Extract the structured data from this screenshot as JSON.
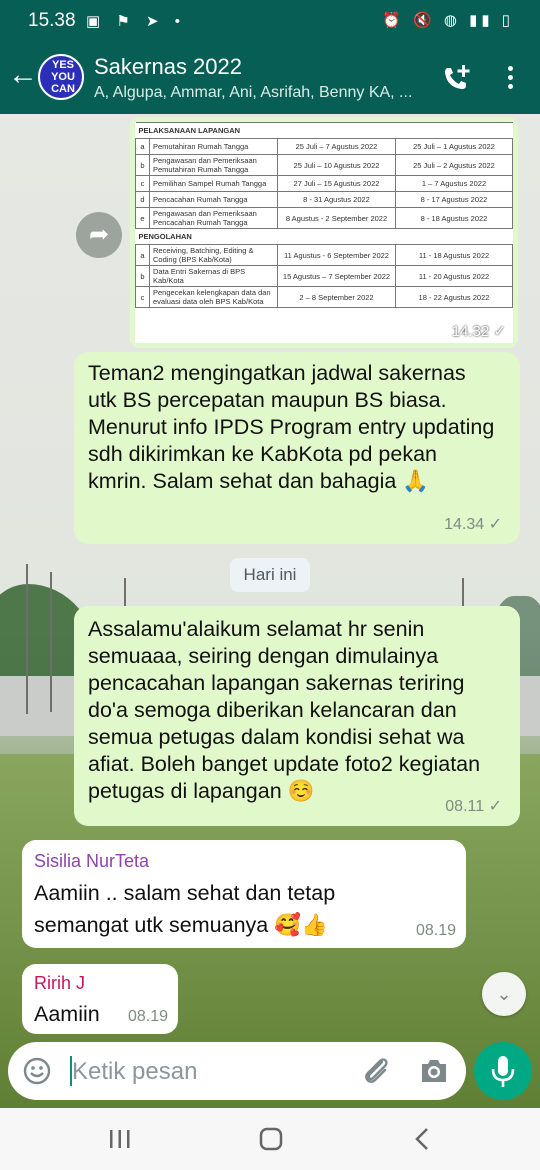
{
  "status_bar": {
    "time": "15.38"
  },
  "header": {
    "avatar_text": [
      "YES",
      "YOU",
      "CAN"
    ],
    "title": "Sakernas 2022",
    "members": "A, Algupa, Ammar, Ani, Asrifah, Benny KA, ..."
  },
  "image_message": {
    "time": "14.32",
    "sections": [
      {
        "title": "PELAKSANAAN LAPANGAN",
        "rows": [
          {
            "k": "a",
            "activity": "Pemutahiran Rumah Tangga",
            "bs_percepatan": "25 Juli – 7 Agustus 2022",
            "bs_biasa": "25 Juli – 1 Agustus 2022"
          },
          {
            "k": "b",
            "activity": "Pengawasan dan Pemeriksaan Pemutahiran Rumah Tangga",
            "bs_percepatan": "25 Juli – 10 Agustus 2022",
            "bs_biasa": "25 Juli – 2 Agustus 2022"
          },
          {
            "k": "c",
            "activity": "Pemilihan Sampel Rumah Tangga",
            "bs_percepatan": "27 Juli – 15 Agustus 2022",
            "bs_biasa": "1 – 7 Agustus 2022"
          },
          {
            "k": "d",
            "activity": "Pencacahan Rumah Tangga",
            "bs_percepatan": "8 - 31 Agustus 2022",
            "bs_biasa": "8 - 17 Agustus 2022"
          },
          {
            "k": "e",
            "activity": "Pengawasan dan Pemeriksaan Pencacahan Rumah Tangga",
            "bs_percepatan": "8 Agustus - 2 September 2022",
            "bs_biasa": "8 - 18 Agustus 2022"
          }
        ]
      },
      {
        "title": "PENGOLAHAN",
        "rows": [
          {
            "k": "a",
            "activity": "Receiving, Batching, Editing & Coding (BPS Kab/Kota)",
            "bs_percepatan": "11 Agustus - 6 September 2022",
            "bs_biasa": "11 - 18 Agustus 2022"
          },
          {
            "k": "b",
            "activity": "Data Entri Sakernas di BPS Kab/Kota",
            "bs_percepatan": "15 Agustus – 7 September 2022",
            "bs_biasa": "11 - 20 Agustus 2022"
          },
          {
            "k": "c",
            "activity": "Pengecekan kelengkapan data dan evaluasi data oleh BPS Kab/Kota",
            "bs_percepatan": "2 – 8 September 2022",
            "bs_biasa": "18 - 22 Agustus 2022"
          }
        ]
      }
    ]
  },
  "messages": [
    {
      "id": "m1",
      "text": "Teman2 mengingatkan jadwal sakernas utk BS percepatan maupun BS biasa. Menurut info IPDS Program entry updating sdh dikirimkan ke KabKota pd pekan kmrin. Salam sehat dan bahagia 🙏",
      "time": "14.34"
    },
    {
      "id": "m2",
      "text": "Assalamu'alaikum selamat hr senin semuaaa, seiring dengan dimulainya pencacahan lapangan sakernas teriring do'a semoga diberikan kelancaran dan semua petugas dalam kondisi sehat wa afiat. Boleh banget update foto2 kegiatan petugas di lapangan ☺️",
      "time": "08.11"
    },
    {
      "id": "m3",
      "sender": "Sisilia NurTeta",
      "sender_color": "#8e44ad",
      "text": "Aamiin .. salam sehat dan tetap semangat utk semuanya 🥰👍",
      "time": "08.19"
    },
    {
      "id": "m4",
      "sender": "Ririh J",
      "sender_color": "#c2185b",
      "text": "Aamiin",
      "time": "08.19"
    }
  ],
  "date_chip": "Hari ini",
  "check_mark": "✓",
  "composer": {
    "placeholder": "Ketik pesan"
  },
  "icons": [
    "back-arrow-icon",
    "add-call-icon",
    "more-options-icon",
    "forward-icon",
    "emoji-icon",
    "attach-icon",
    "camera-icon",
    "mic-icon",
    "scroll-down-icon"
  ],
  "colors": {
    "header": "#075e54",
    "outgoing_bubble": "#e1f8cb",
    "accent": "#00a884"
  }
}
